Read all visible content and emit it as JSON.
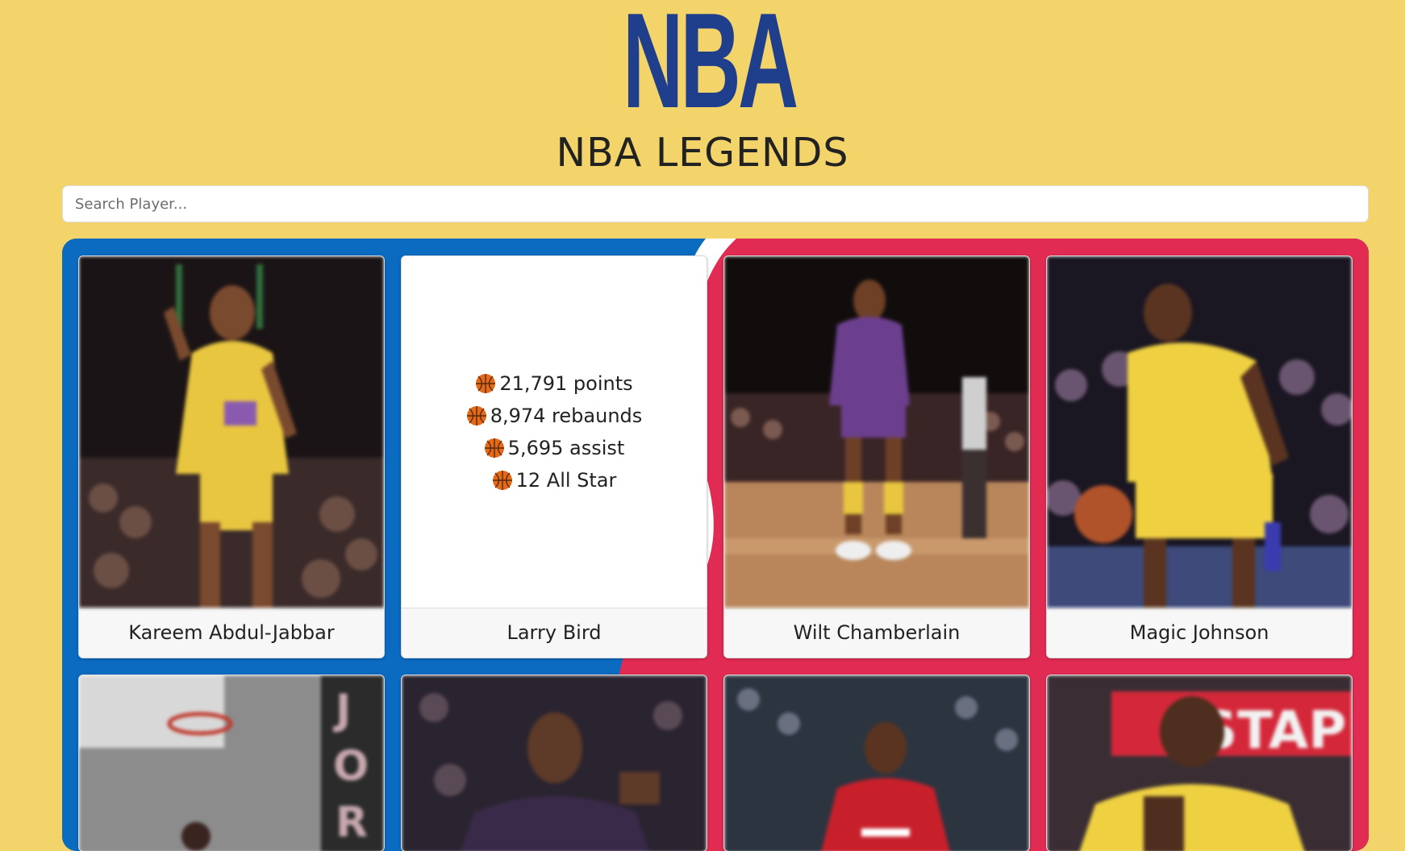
{
  "header": {
    "logo_text": "NBA",
    "title": "NBA LEGENDS"
  },
  "search": {
    "placeholder": "Search Player...",
    "value": ""
  },
  "colors": {
    "background": "#f3d46b",
    "board_blue": "#0a6bc1",
    "board_red": "#e22b52",
    "logo_blue": "#1f3e8c"
  },
  "players": [
    {
      "name": "Kareem Abdul-Jabbar",
      "photo": "kareem-photo"
    },
    {
      "name": "Larry Bird",
      "photo": "bird-photo",
      "flipped": true,
      "stats": [
        "21,791 points",
        "8,974 rebaunds",
        "5,695 assist",
        "12 All Star"
      ]
    },
    {
      "name": "Wilt Chamberlain",
      "photo": "wilt-photo"
    },
    {
      "name": "Magic Johnson",
      "photo": "magic-photo"
    }
  ],
  "stat_icon": "basketball-icon"
}
